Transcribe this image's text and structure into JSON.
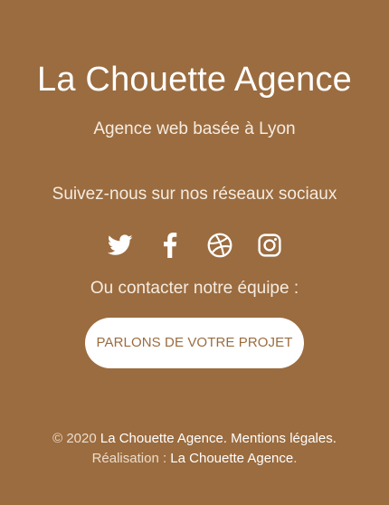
{
  "brand": {
    "title": "La Chouette Agence",
    "tagline": "Agence web basée à Lyon"
  },
  "social": {
    "heading": "Suivez-nous sur nos réseaux sociaux",
    "icons": [
      {
        "name": "twitter-icon"
      },
      {
        "name": "facebook-icon"
      },
      {
        "name": "dribbble-icon"
      },
      {
        "name": "instagram-icon"
      }
    ]
  },
  "contact": {
    "heading": "Ou contacter notre équipe :",
    "cta_label": "PARLONS DE VOTRE PROJET"
  },
  "credits": {
    "copyright_prefix": "© 2020",
    "agency_link": "La Chouette Agence.",
    "legal_link": "Mentions légales.",
    "realisation_prefix": "Réalisation :",
    "realisation_link": "La Chouette Agence",
    "realisation_suffix": "."
  },
  "colors": {
    "background": "#9b6c3f",
    "button_text": "#9b6c3f",
    "button_bg": "#ffffff"
  }
}
